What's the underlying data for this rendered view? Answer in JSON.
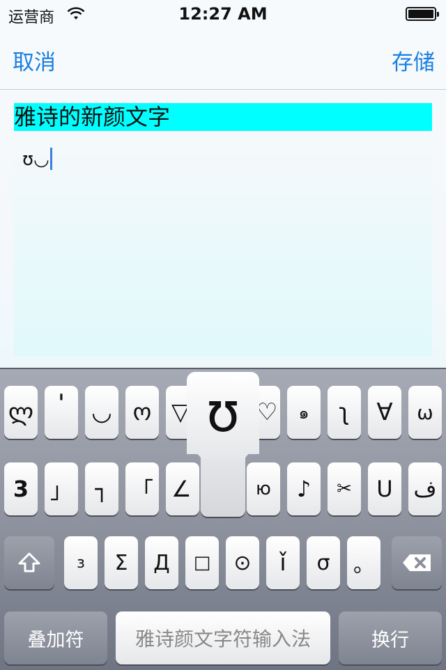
{
  "status_bar": {
    "carrier": "运营商",
    "time": "12:27 AM",
    "icons": [
      "wifi-icon",
      "battery-icon"
    ]
  },
  "nav": {
    "cancel": "取消",
    "save": "存储"
  },
  "editor": {
    "title": "雅诗的新颜文字",
    "content": "ʊ◡"
  },
  "keyboard": {
    "row1": [
      "ლ",
      "ˈ",
      "◡",
      "ო",
      "▽",
      "ʊ",
      "♡",
      "๑",
      "ʅ",
      "∀",
      "ω"
    ],
    "row2": [
      "3",
      "」",
      "┐",
      "「",
      "∠",
      "",
      "ю",
      "♪",
      "✂",
      "ᑌ",
      "ف"
    ],
    "row3": [
      "з",
      "Σ",
      "Д",
      "□",
      "⊙",
      "ǐ",
      "σ",
      "。"
    ],
    "popup_char": "ʊ",
    "bottom": {
      "left": "叠加符",
      "space": "雅诗颜文字符输入法",
      "right": "换行"
    },
    "shift_icon": "shift-arrow-icon",
    "delete_icon": "backspace-icon"
  }
}
